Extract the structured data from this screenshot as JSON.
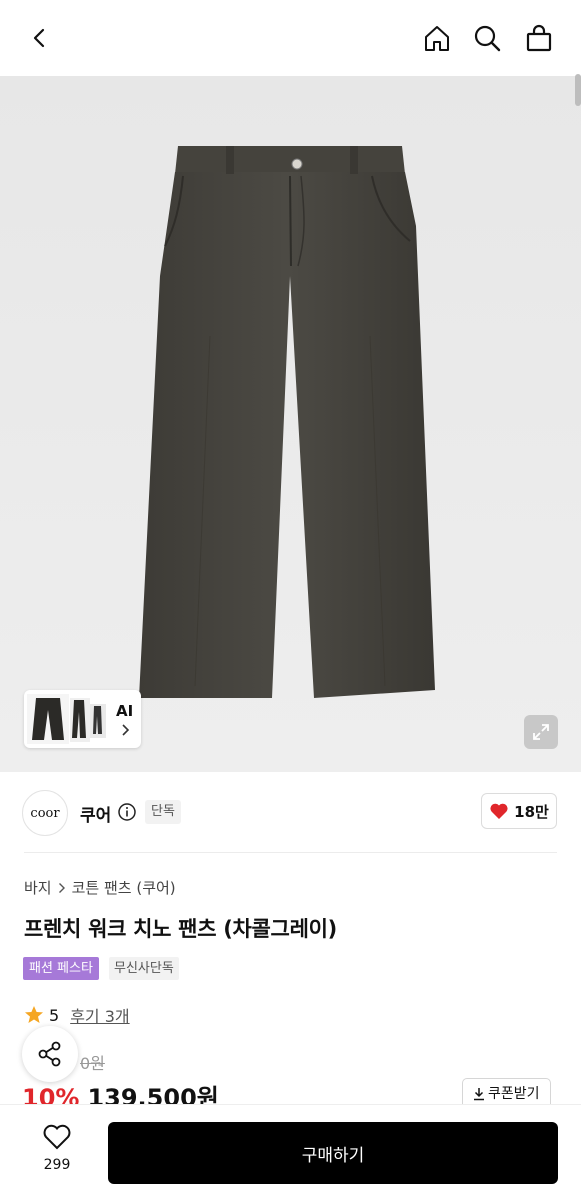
{
  "header": {
    "back_icon": "chevron-left-icon",
    "home_icon": "home-icon",
    "search_icon": "search-icon",
    "cart_icon": "shopping-bag-icon"
  },
  "gallery": {
    "ai_label": "AI",
    "expand_icon": "expand-icon"
  },
  "brand": {
    "logo_text": "coor",
    "name": "쿠어",
    "badge": "단독",
    "likes": "18만",
    "heart_color": "#e0262b"
  },
  "product": {
    "breadcrumb": [
      "바지",
      "코튼 팬츠 (쿠어)"
    ],
    "title": "프렌치 워크 치노 팬츠 (차콜그레이)",
    "tags": [
      "패션 페스타",
      "무신사단독"
    ],
    "tag_color": "#a679d8",
    "rating": "5",
    "reviews": "후기 3개",
    "original_price": "0원",
    "discount": "10%",
    "price": "139,500원",
    "coupon_label": "쿠폰받기",
    "discount_color": "#e0262b"
  },
  "bottom": {
    "wish_count": "299",
    "buy_label": "구매하기"
  }
}
